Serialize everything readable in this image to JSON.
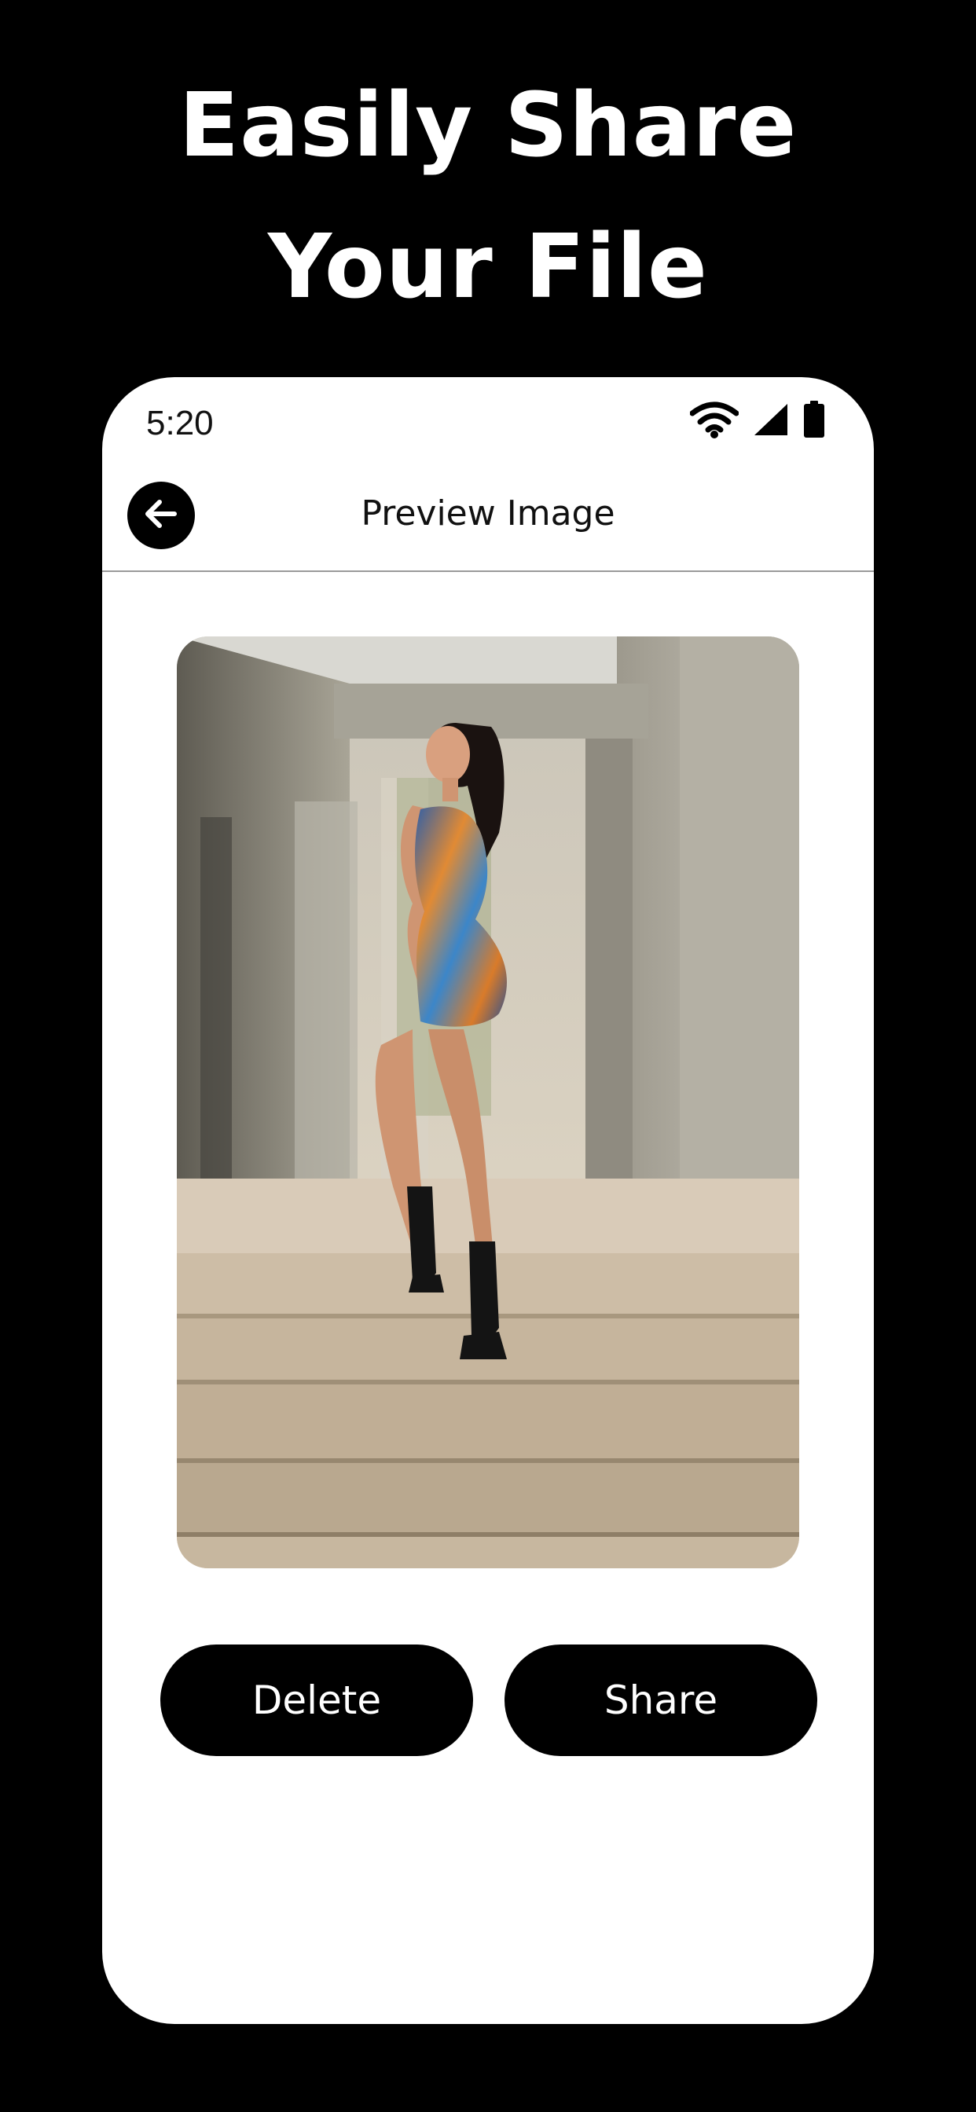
{
  "promo": {
    "line1": "Easily Share",
    "line2": "Your File"
  },
  "status_bar": {
    "time": "5:20",
    "icons": [
      "wifi-icon",
      "cellular-signal-icon",
      "battery-icon"
    ]
  },
  "app_bar": {
    "title": "Preview Image",
    "back_icon": "arrow-left-icon"
  },
  "actions": {
    "delete_label": "Delete",
    "share_label": "Share"
  },
  "colors": {
    "background": "#000000",
    "screen": "#ffffff",
    "button": "#000000",
    "button_text": "#ffffff"
  }
}
